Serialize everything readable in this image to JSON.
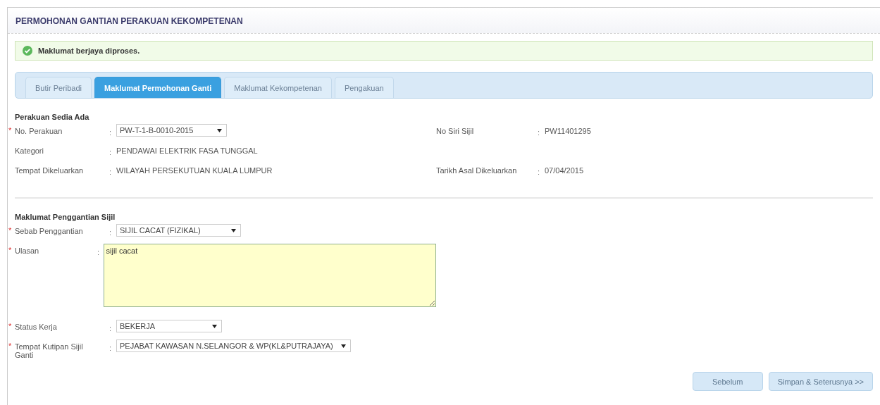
{
  "title": "PERMOHONAN GANTIAN PERAKUAN KEKOMPETENAN",
  "alert": {
    "kind": "success",
    "message": "Maklumat berjaya diproses."
  },
  "tabs": [
    {
      "label": "Butir Peribadi",
      "selected": false
    },
    {
      "label": "Maklumat Permohonan Ganti",
      "selected": true
    },
    {
      "label": "Maklumat Kekompetenan",
      "selected": false
    },
    {
      "label": "Pengakuan",
      "selected": false
    }
  ],
  "sections": [
    {
      "heading": "Perakuan Sedia Ada",
      "rows": [
        {
          "left": {
            "label": "No. Perakuan",
            "required_mark": "*",
            "separator": ":",
            "kind": "select",
            "value": "PW-T-1-B-0010-2015"
          },
          "right": {
            "label": "No Siri Sijil",
            "separator": ":",
            "kind": "text",
            "value": "PW11401295"
          }
        },
        {
          "left": {
            "label": "Kategori",
            "separator": ":",
            "kind": "text",
            "value": "PENDAWAI ELEKTRIK FASA TUNGGAL"
          }
        },
        {
          "left": {
            "label": "Tempat Dikeluarkan",
            "separator": ":",
            "kind": "text",
            "value": "WILAYAH PERSEKUTUAN KUALA LUMPUR"
          },
          "right": {
            "label": "Tarikh Asal Dikeluarkan",
            "separator": ":",
            "kind": "text",
            "value": "07/04/2015"
          }
        }
      ]
    },
    {
      "heading": "Maklumat Penggantian Sijil",
      "rows": [
        {
          "left": {
            "label": "Sebab Penggantian",
            "required_mark": "*",
            "separator": ":",
            "kind": "select",
            "value": "SIJIL CACAT (FIZIKAL)"
          }
        },
        {
          "left": {
            "label": "Ulasan",
            "required_mark": "*",
            "separator": ":",
            "kind": "textarea",
            "value": "sijil cacat"
          }
        },
        {
          "left": {
            "label": "Status Kerja",
            "required_mark": "*",
            "separator": ":",
            "kind": "select",
            "value": "BEKERJA"
          }
        },
        {
          "left": {
            "label": "Tempat Kutipan Sijil Ganti",
            "required_mark": "*",
            "separator": ":",
            "kind": "select",
            "value": "PEJABAT KAWASAN N.SELANGOR & WP(KL&PUTRAJAYA)"
          }
        }
      ]
    }
  ],
  "buttons": [
    "Sebelum",
    "Simpan & Seterusnya >>"
  ]
}
